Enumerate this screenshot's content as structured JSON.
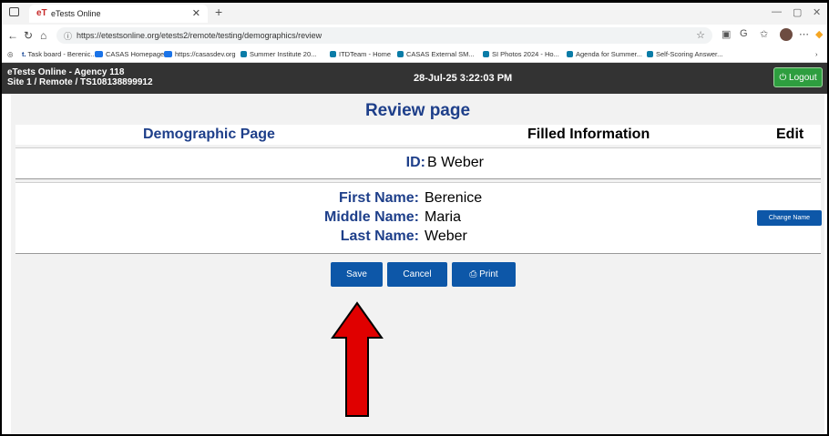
{
  "browser": {
    "tab_title": "eTests Online",
    "url": "https://etestsonline.org/etests2/remote/testing/demographics/review",
    "bookmarks": [
      "Task board - Berenic...",
      "CASAS Homepage",
      "https://casasdev.org",
      "Summer Institute 20...",
      "ITDTeam - Home",
      "CASAS External SM...",
      "SI Photos 2024 - Ho...",
      "Agenda for Summer...",
      "Self-Scoring Answer..."
    ]
  },
  "header": {
    "agency": "eTests Online - Agency 118",
    "site": "Site 1 / Remote / TS108138899912",
    "datetime": "28-Jul-25 3:22:03 PM",
    "logout_label": "Logout"
  },
  "page": {
    "title": "Review page",
    "columns": {
      "demographic": "Demographic Page",
      "filled": "Filled Information",
      "edit": "Edit"
    },
    "id_label": "ID:",
    "id_value": "B Weber",
    "first_name_label": "First Name:",
    "first_name_value": "Berenice",
    "middle_name_label": "Middle Name:",
    "middle_name_value": "Maria",
    "last_name_label": "Last Name:",
    "last_name_value": "Weber",
    "change_name_label": "Change Name"
  },
  "actions": {
    "save_label": "Save",
    "cancel_label": "Cancel",
    "print_label": "Print"
  },
  "colors": {
    "accent_blue": "#0d57a8",
    "title_blue": "#1e3f8a",
    "header_bg": "#333333",
    "logout_green": "#2e9e3f",
    "arrow_red": "#e00000"
  }
}
